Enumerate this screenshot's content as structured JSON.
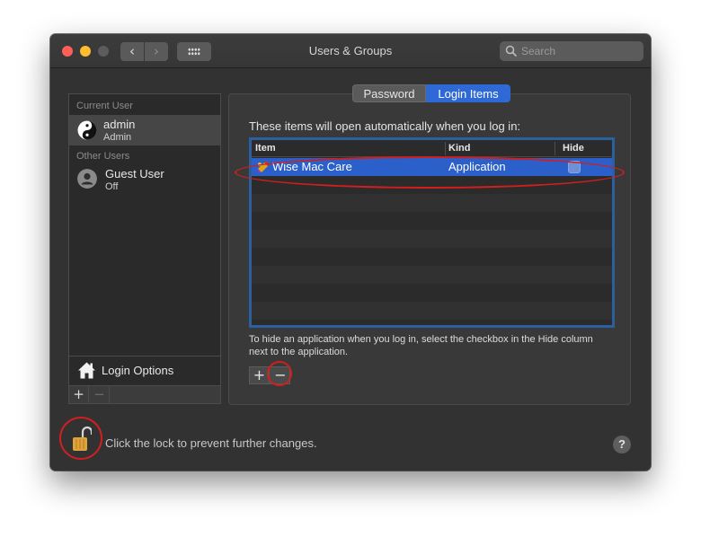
{
  "window": {
    "title": "Users & Groups",
    "search_placeholder": "Search"
  },
  "toolbar": {
    "back_glyph": "‹",
    "forward_glyph": "›"
  },
  "sidebar": {
    "current_user_header": "Current User",
    "current_user": {
      "name": "admin",
      "role": "Admin",
      "avatar": "yin-yang-icon"
    },
    "other_users_header": "Other Users",
    "other_users": [
      {
        "name": "Guest User",
        "status": "Off",
        "avatar": "person-icon"
      }
    ],
    "login_options_label": "Login Options",
    "add_glyph": "+",
    "remove_glyph": "−"
  },
  "tabs": [
    {
      "label": "Password",
      "active": false
    },
    {
      "label": "Login Items",
      "active": true
    }
  ],
  "login_items": {
    "description": "These items will open automatically when you log in:",
    "columns": [
      "Item",
      "Kind",
      "Hide"
    ],
    "rows": [
      {
        "item": "Wise Mac Care",
        "kind": "Application",
        "hide": false,
        "selected": true
      }
    ],
    "hint": "To hide an application when you log in, select the checkbox in the Hide column next to the application.",
    "add_glyph": "+",
    "remove_glyph": "−"
  },
  "footer": {
    "lock_text": "Click the lock to prevent further changes.",
    "help_glyph": "?"
  },
  "colors": {
    "accent": "#2f69d6",
    "selection": "#2b5fc9",
    "annotation": "#d01f1f"
  }
}
